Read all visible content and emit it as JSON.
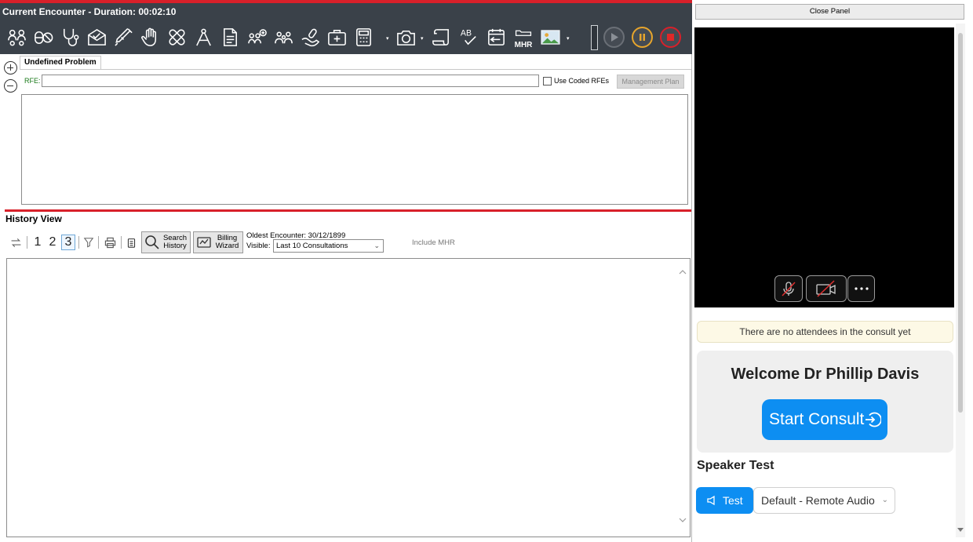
{
  "header": {
    "title": "Current Encounter - Duration: 00:02:10",
    "accent_color": "#d8202a",
    "background": "#3a4149",
    "toolbar": {
      "icons": [
        "people-link-icon",
        "pills-icon",
        "stethoscope-icon",
        "envelope-icon",
        "syringe-icon",
        "hand-icon",
        "bandage-icon",
        "compass-icon",
        "document-icon",
        "family-add-icon",
        "family-icon",
        "hand-pill-icon",
        "medical-kit-icon",
        "calculator-icon",
        "camera-icon",
        "scroll-icon",
        "spellcheck-icon",
        "calendar-back-icon",
        "mhr-icon",
        "image-gallery-icon"
      ],
      "mhr_label": "MHR",
      "spellcheck_label": "AB"
    }
  },
  "problem": {
    "tab_label": "Undefined Problem",
    "rfe_label": "RFE:",
    "rfe_value": "",
    "use_coded_label": "Use Coded RFEs",
    "use_coded_checked": false,
    "management_plan_label": "Management Plan"
  },
  "history": {
    "title": "History View",
    "levels": [
      "1",
      "2",
      "3"
    ],
    "selected_level": "3",
    "search_label_1": "Search",
    "search_label_2": "History",
    "billing_label_1": "Billing",
    "billing_label_2": "Wizard",
    "oldest_encounter": "Oldest Encounter: 30/12/1899",
    "visible_label": "Visible:",
    "visible_value": "Last 10 Consultations",
    "include_mhr": "Include MHR"
  },
  "panel": {
    "close_label": "Close Panel",
    "no_attendees": "There are no attendees in the consult yet",
    "welcome": "Welcome Dr Phillip Davis",
    "start_label": "Start Consult",
    "speaker_title": "Speaker Test",
    "test_label": "Test",
    "audio_device": "Default - Remote Audio",
    "brand_color": "#0d8ef2"
  }
}
